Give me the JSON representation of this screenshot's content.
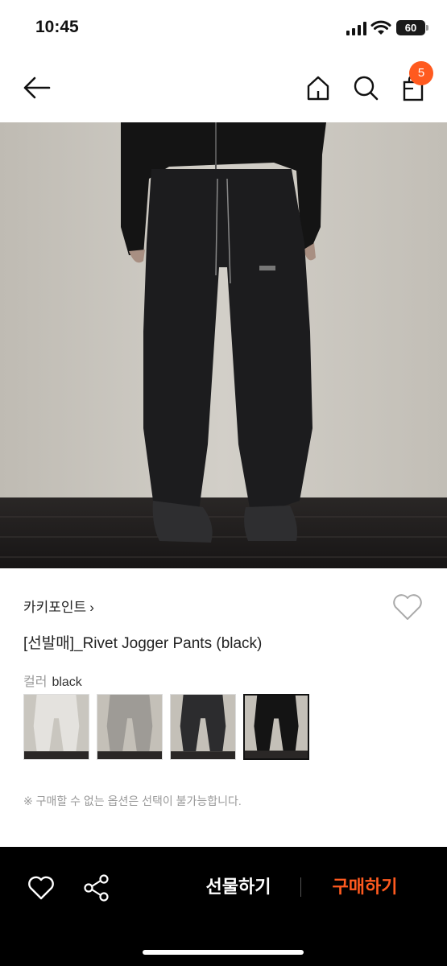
{
  "status_bar": {
    "time": "10:45",
    "battery": "60"
  },
  "header": {
    "cart_count": "5"
  },
  "product": {
    "brand": "카키포인트",
    "title": "[선발매]_Rivet Jogger Pants (black)",
    "color_label": "컬러",
    "color_value": "black",
    "notice": "※ 구매할 수 없는 옵션은 선택이 불가능합니다.",
    "swatches": [
      {
        "color": "light-gray",
        "selected": false
      },
      {
        "color": "gray",
        "selected": false
      },
      {
        "color": "charcoal",
        "selected": false
      },
      {
        "color": "black",
        "selected": true
      }
    ]
  },
  "bottom_bar": {
    "gift_label": "선물하기",
    "buy_label": "구매하기"
  },
  "colors": {
    "accent": "#ff5a1f",
    "bottom_bar_bg": "#000000"
  },
  "icons": [
    "back-arrow-icon",
    "home-icon",
    "search-icon",
    "shopping-bag-icon",
    "heart-icon",
    "share-icon",
    "chevron-right-icon"
  ]
}
